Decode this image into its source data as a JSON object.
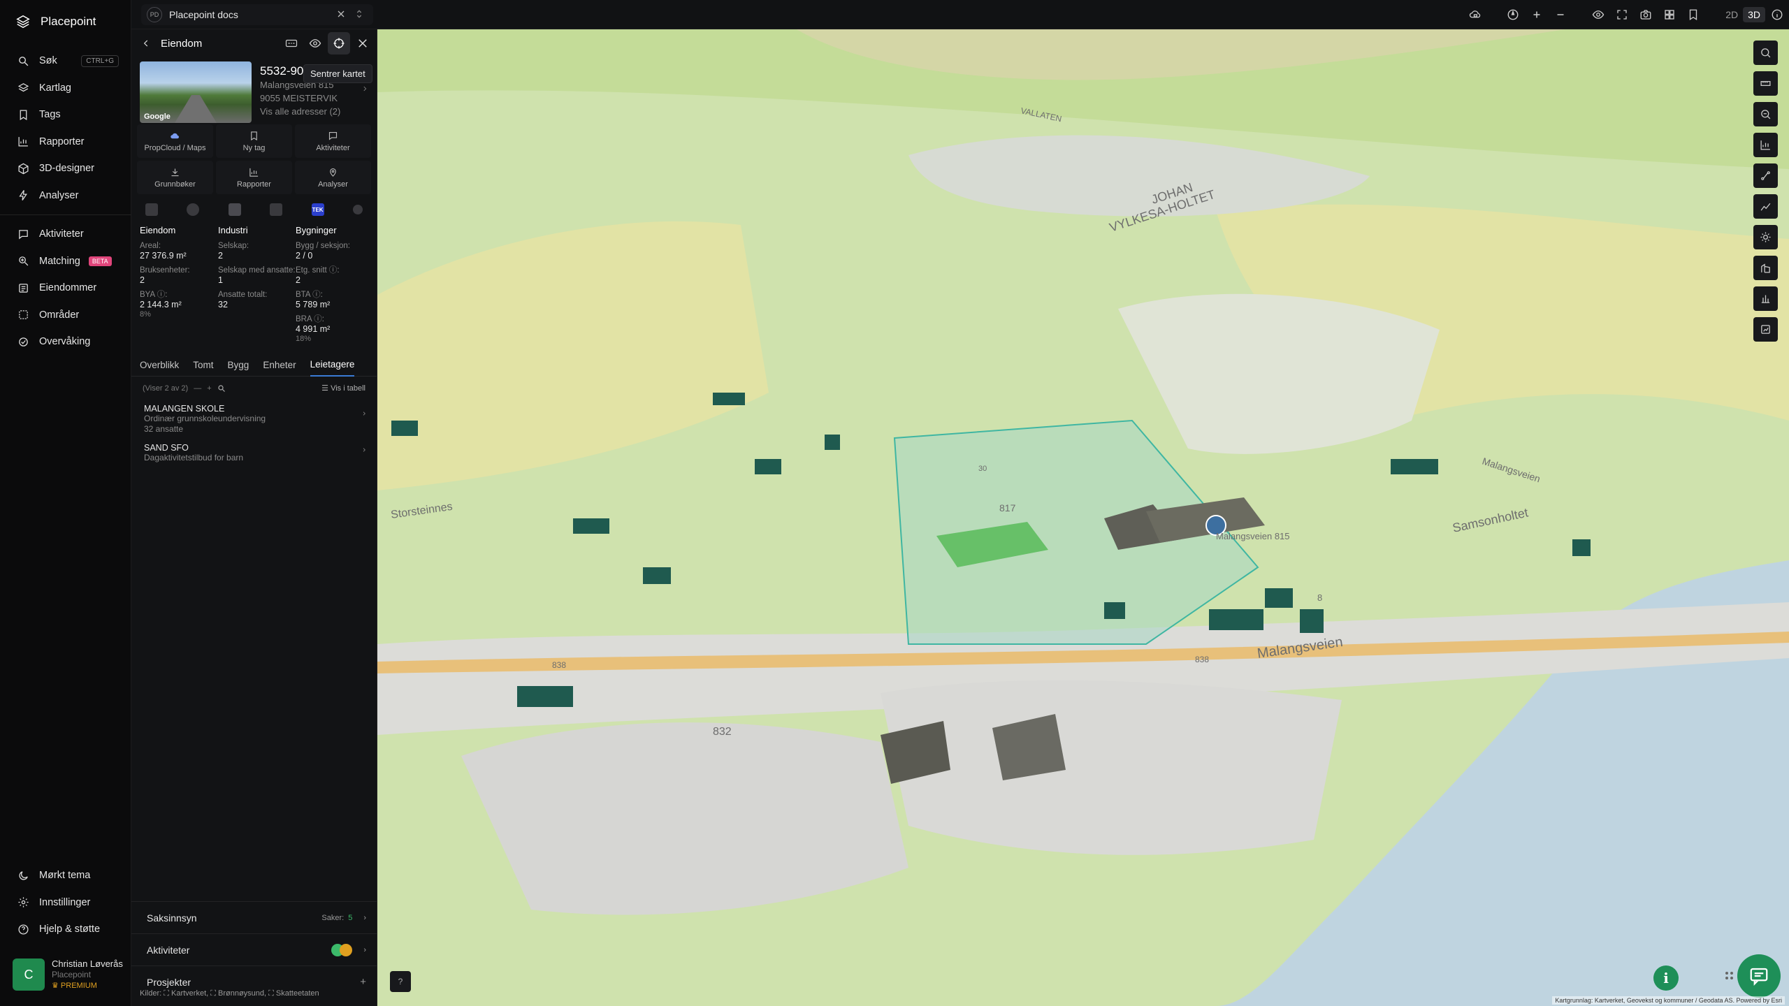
{
  "app": {
    "name": "Placepoint"
  },
  "nav": {
    "items": [
      {
        "label": "Søk",
        "shortcut": "CTRL+G",
        "icon": "search-icon"
      },
      {
        "label": "Kartlag",
        "icon": "layers-icon"
      },
      {
        "label": "Tags",
        "icon": "bookmark-icon"
      },
      {
        "label": "Rapporter",
        "icon": "chart-icon"
      },
      {
        "label": "3D-designer",
        "icon": "cube-icon"
      },
      {
        "label": "Analyser",
        "icon": "bolt-icon"
      }
    ],
    "items2": [
      {
        "label": "Aktiviteter",
        "icon": "chat-icon"
      },
      {
        "label": "Matching",
        "badge": "BETA",
        "icon": "search-sparkle-icon"
      },
      {
        "label": "Eiendommer",
        "icon": "list-icon"
      },
      {
        "label": "Områder",
        "icon": "area-icon"
      },
      {
        "label": "Overvåking",
        "icon": "monitor-icon"
      }
    ],
    "bottom": [
      {
        "label": "Mørkt tema",
        "icon": "moon-icon"
      },
      {
        "label": "Innstillinger",
        "icon": "gear-icon"
      },
      {
        "label": "Hjelp & støtte",
        "icon": "help-icon"
      }
    ]
  },
  "user": {
    "initial": "C",
    "name": "Christian Løverås",
    "org": "Placepoint",
    "plan": "PREMIUM"
  },
  "topbar": {
    "tab_badge": "PD",
    "tab_title": "Placepoint docs",
    "mode_2d": "2D",
    "mode_3d": "3D"
  },
  "panel": {
    "title": "Eiendom",
    "tooltip": "Sentrer kartet",
    "property": {
      "id": "5532-90",
      "address": "Malangsveien 815",
      "postal": "9055 MEISTERVIK",
      "all_addresses": "Vis alle adresser (2)",
      "thumb_label": "Google"
    },
    "actions": [
      {
        "label": "PropCloud / Maps",
        "icon": "cloud-icon"
      },
      {
        "label": "Ny tag",
        "icon": "bookmark-icon"
      },
      {
        "label": "Aktiviteter",
        "icon": "chat-icon"
      },
      {
        "label": "Grunnbøker",
        "icon": "download-icon"
      },
      {
        "label": "Rapporter",
        "icon": "chart-icon"
      },
      {
        "label": "Analyser",
        "icon": "bolt-icon"
      }
    ],
    "tek_label": "TEK",
    "stats": {
      "eiendom": {
        "title": "Eiendom",
        "areal_label": "Areal:",
        "areal": "27 376.9 m²",
        "bruk_label": "Bruksenheter:",
        "bruk": "2",
        "bya_label": "BYA ⓘ:",
        "bya": "2 144.3 m²",
        "bya_pct": "8%"
      },
      "industri": {
        "title": "Industri",
        "selskap_label": "Selskap:",
        "selskap": "2",
        "ansatte_label": "Selskap med ansatte:",
        "ansatte": "1",
        "totalt_label": "Ansatte totalt:",
        "totalt": "32"
      },
      "bygninger": {
        "title": "Bygninger",
        "bygg_label": "Bygg / seksjon:",
        "bygg": "2 / 0",
        "etg_label": "Etg. snitt ⓘ:",
        "etg": "2",
        "bta_label": "BTA ⓘ:",
        "bta": "5 789 m²",
        "bra_label": "BRA ⓘ:",
        "bra": "4 991 m²",
        "bra_pct": "18%"
      }
    },
    "tabs": [
      "Overblikk",
      "Tomt",
      "Bygg",
      "Enheter",
      "Leietagere"
    ],
    "active_tab": "Leietagere",
    "list_count": "(Viser 2 av 2)",
    "list_view": "Vis i tabell",
    "tenants": [
      {
        "name": "MALANGEN SKOLE",
        "desc": "Ordinær grunnskoleundervisning",
        "employees": "32 ansatte"
      },
      {
        "name": "SAND SFO",
        "desc": "Dagaktivitetstilbud for barn",
        "employees": ""
      }
    ],
    "sections": [
      {
        "label": "Saksinnsyn",
        "right_label": "Saker:",
        "right_value": "5"
      },
      {
        "label": "Aktiviteter"
      },
      {
        "label": "Prosjekter",
        "right_value": "+"
      }
    ],
    "sources": "Kilder: ⛶ Kartverket, ⛶ Brønnøysund, ⛶ Skatteetaten"
  },
  "map": {
    "labels": {
      "road": "Malangsveien",
      "road2": "Malangsveien",
      "place1": "JOHAN",
      "place2": "VYLKESA-HOLTET",
      "place3": "Storsteinnes",
      "place4": "Samsonholtet",
      "place5": "VALLATEN",
      "pin": "Malangsveien 815",
      "e1": "817",
      "e2": "832",
      "e3": "838",
      "e4": "838",
      "e5": "30",
      "e6": "8"
    },
    "attribution": "Kartgrunnlag: Kartverket, Geovekst og kommuner / Geodata AS. Powered by Esri",
    "colors": {
      "grass": "#c4dc98",
      "field": "#e2e3a5",
      "water": "#bfd4e0",
      "highlight": "#7bc5b4",
      "building": "#1f5a4f"
    }
  }
}
